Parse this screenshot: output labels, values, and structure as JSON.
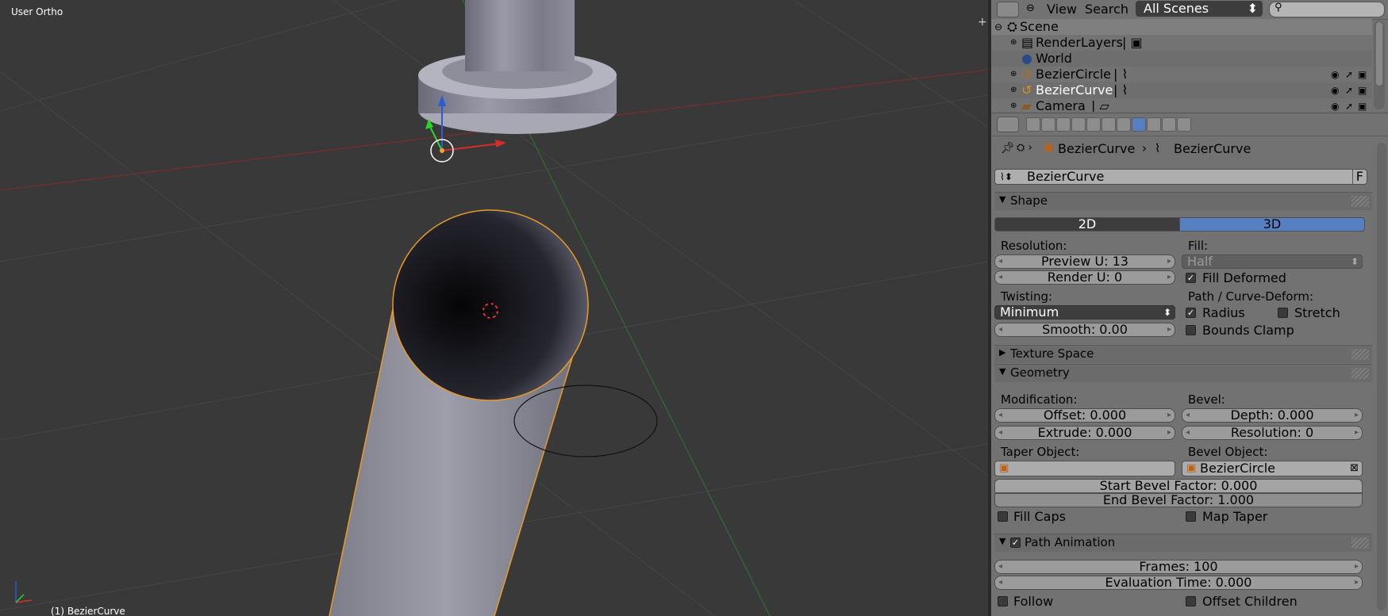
{
  "viewport": {
    "view_label": "User Ortho",
    "object_label": "(1) BezierCurve"
  },
  "outliner_header": {
    "view_menu": "View",
    "search_menu": "Search",
    "scene_selector": "All Scenes"
  },
  "outliner": {
    "items": [
      {
        "label": "Scene",
        "icon": "scene-icon"
      },
      {
        "label": "RenderLayers",
        "icon": "render-layers-icon"
      },
      {
        "label": "World",
        "icon": "world-icon"
      },
      {
        "label": "BezierCircle",
        "icon": "curve-object-icon"
      },
      {
        "label": "BezierCurve",
        "icon": "curve-object-icon"
      },
      {
        "label": "Camera",
        "icon": "camera-icon"
      }
    ]
  },
  "properties": {
    "breadcrumb": {
      "object": "BezierCurve",
      "data": "BezierCurve"
    },
    "datablock": {
      "name": "BezierCurve",
      "fake_user": "F"
    },
    "shape": {
      "title": "Shape",
      "mode_2d": "2D",
      "mode_3d": "3D",
      "resolution_label": "Resolution:",
      "preview_u": "Preview U: 13",
      "render_u": "Render U: 0",
      "fill_label": "Fill:",
      "fill_value": "Half",
      "fill_deformed": "Fill Deformed",
      "twisting_label": "Twisting:",
      "twisting_value": "Minimum",
      "smooth": "Smooth: 0.00",
      "path_deform_label": "Path / Curve-Deform:",
      "radius": "Radius",
      "stretch": "Stretch",
      "bounds_clamp": "Bounds Clamp"
    },
    "texture_space": {
      "title": "Texture Space"
    },
    "geometry": {
      "title": "Geometry",
      "modification_label": "Modification:",
      "offset": "Offset: 0.000",
      "extrude": "Extrude: 0.000",
      "bevel_label": "Bevel:",
      "depth": "Depth: 0.000",
      "resolution": "Resolution: 0",
      "taper_label": "Taper Object:",
      "bevel_object_label": "Bevel Object:",
      "bevel_object_value": "BezierCircle",
      "start_bevel": "Start Bevel Factor: 0.000",
      "end_bevel": "End Bevel Factor: 1.000",
      "fill_caps": "Fill Caps",
      "map_taper": "Map Taper"
    },
    "path_animation": {
      "title": "Path Animation",
      "frames": "Frames: 100",
      "eval_time": "Evaluation Time: 0.000",
      "follow": "Follow",
      "offset_children": "Offset Children"
    }
  },
  "colors": {
    "active_tab": "#5680c2",
    "selection_outline": "#f0a030",
    "x_axis": "#c03030",
    "y_axis": "#3a9a3a"
  }
}
